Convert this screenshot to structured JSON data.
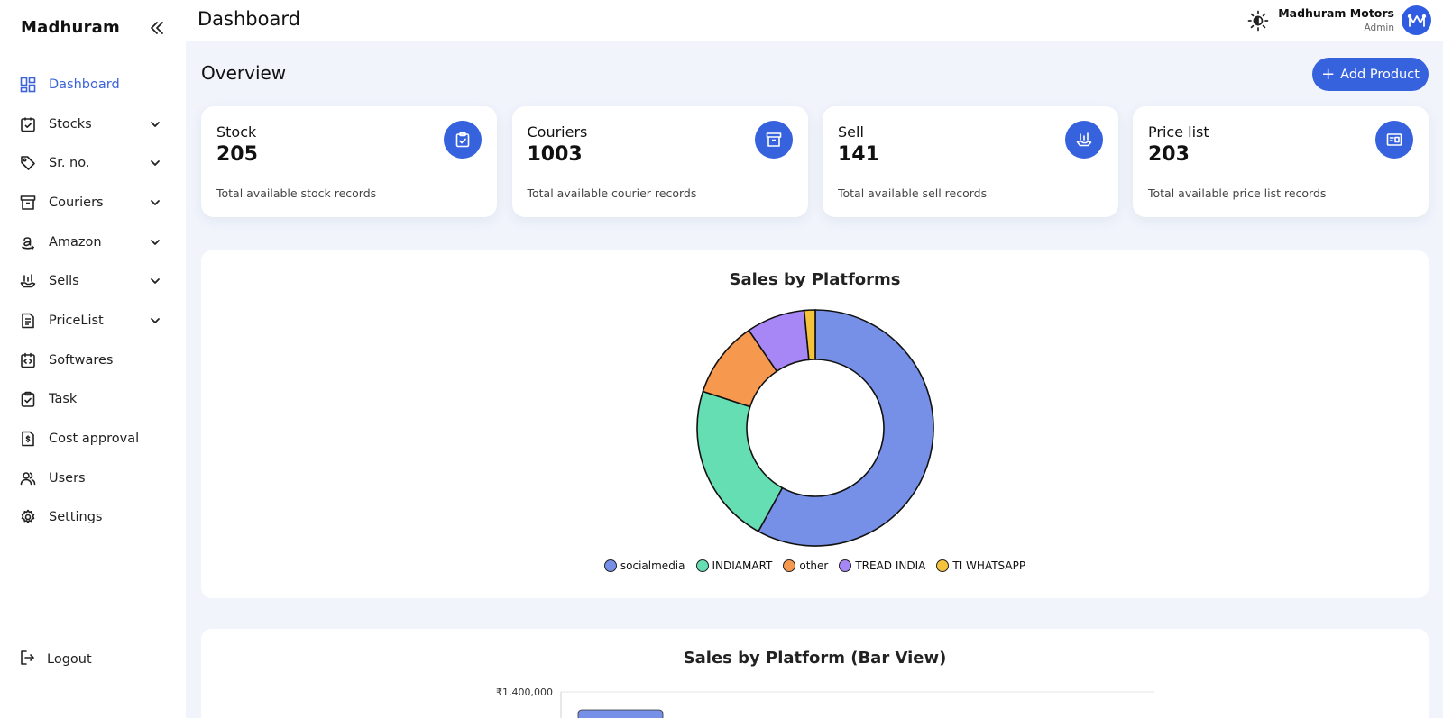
{
  "sidebar": {
    "brand": "Madhuram",
    "items": [
      {
        "label": "Dashboard",
        "icon": "dashboard-grid-icon",
        "expandable": false,
        "active": true
      },
      {
        "label": "Stocks",
        "icon": "clipboard-check-icon",
        "expandable": true
      },
      {
        "label": "Sr. no.",
        "icon": "tag-icon",
        "expandable": true
      },
      {
        "label": "Couriers",
        "icon": "archive-box-icon",
        "expandable": true
      },
      {
        "label": "Amazon",
        "icon": "amazon-icon",
        "expandable": true
      },
      {
        "label": "Sells",
        "icon": "hand-chart-icon",
        "expandable": true
      },
      {
        "label": "PriceList",
        "icon": "document-icon",
        "expandable": true
      },
      {
        "label": "Softwares",
        "icon": "code-calendar-icon",
        "expandable": false
      },
      {
        "label": "Task",
        "icon": "clipboard-task-icon",
        "expandable": false
      },
      {
        "label": "Cost approval",
        "icon": "dollar-document-icon",
        "expandable": false
      },
      {
        "label": "Users",
        "icon": "users-icon",
        "expandable": false
      },
      {
        "label": "Settings",
        "icon": "gear-icon",
        "expandable": false
      }
    ],
    "logout": "Logout"
  },
  "header": {
    "title": "Dashboard",
    "user_name": "Madhuram Motors",
    "user_role": "Admin"
  },
  "main": {
    "overview": "Overview",
    "add_product": "Add Product",
    "cards": [
      {
        "title": "Stock",
        "value": "205",
        "desc": "Total available stock records",
        "icon": "clipboard-check-icon"
      },
      {
        "title": "Couriers",
        "value": "1003",
        "desc": "Total available courier records",
        "icon": "archive-box-icon"
      },
      {
        "title": "Sell",
        "value": "141",
        "desc": "Total available sell records",
        "icon": "hand-chart-icon"
      },
      {
        "title": "Price list",
        "value": "203",
        "desc": "Total available price list records",
        "icon": "id-card-icon"
      }
    ]
  },
  "colors": {
    "accent": "#3762de",
    "active_text": "#3b63d9",
    "background": "#f1f4fb"
  },
  "chart_data": [
    {
      "type": "pie",
      "title": "Sales by Platforms",
      "categories": [
        "socialmedia",
        "INDIAMART",
        "other",
        "TREAD INDIA",
        "TI WHATSAPP"
      ],
      "values": [
        58,
        22,
        10.5,
        8,
        1.5
      ],
      "colors": [
        "#7590e6",
        "#64deb2",
        "#f7984f",
        "#a787f5",
        "#f5c33b"
      ],
      "legend": "bottom"
    },
    {
      "type": "bar",
      "title": "Sales by Platform (Bar View)",
      "y_ticks": [
        "₹1,400,000"
      ],
      "categories": [],
      "values": []
    }
  ]
}
